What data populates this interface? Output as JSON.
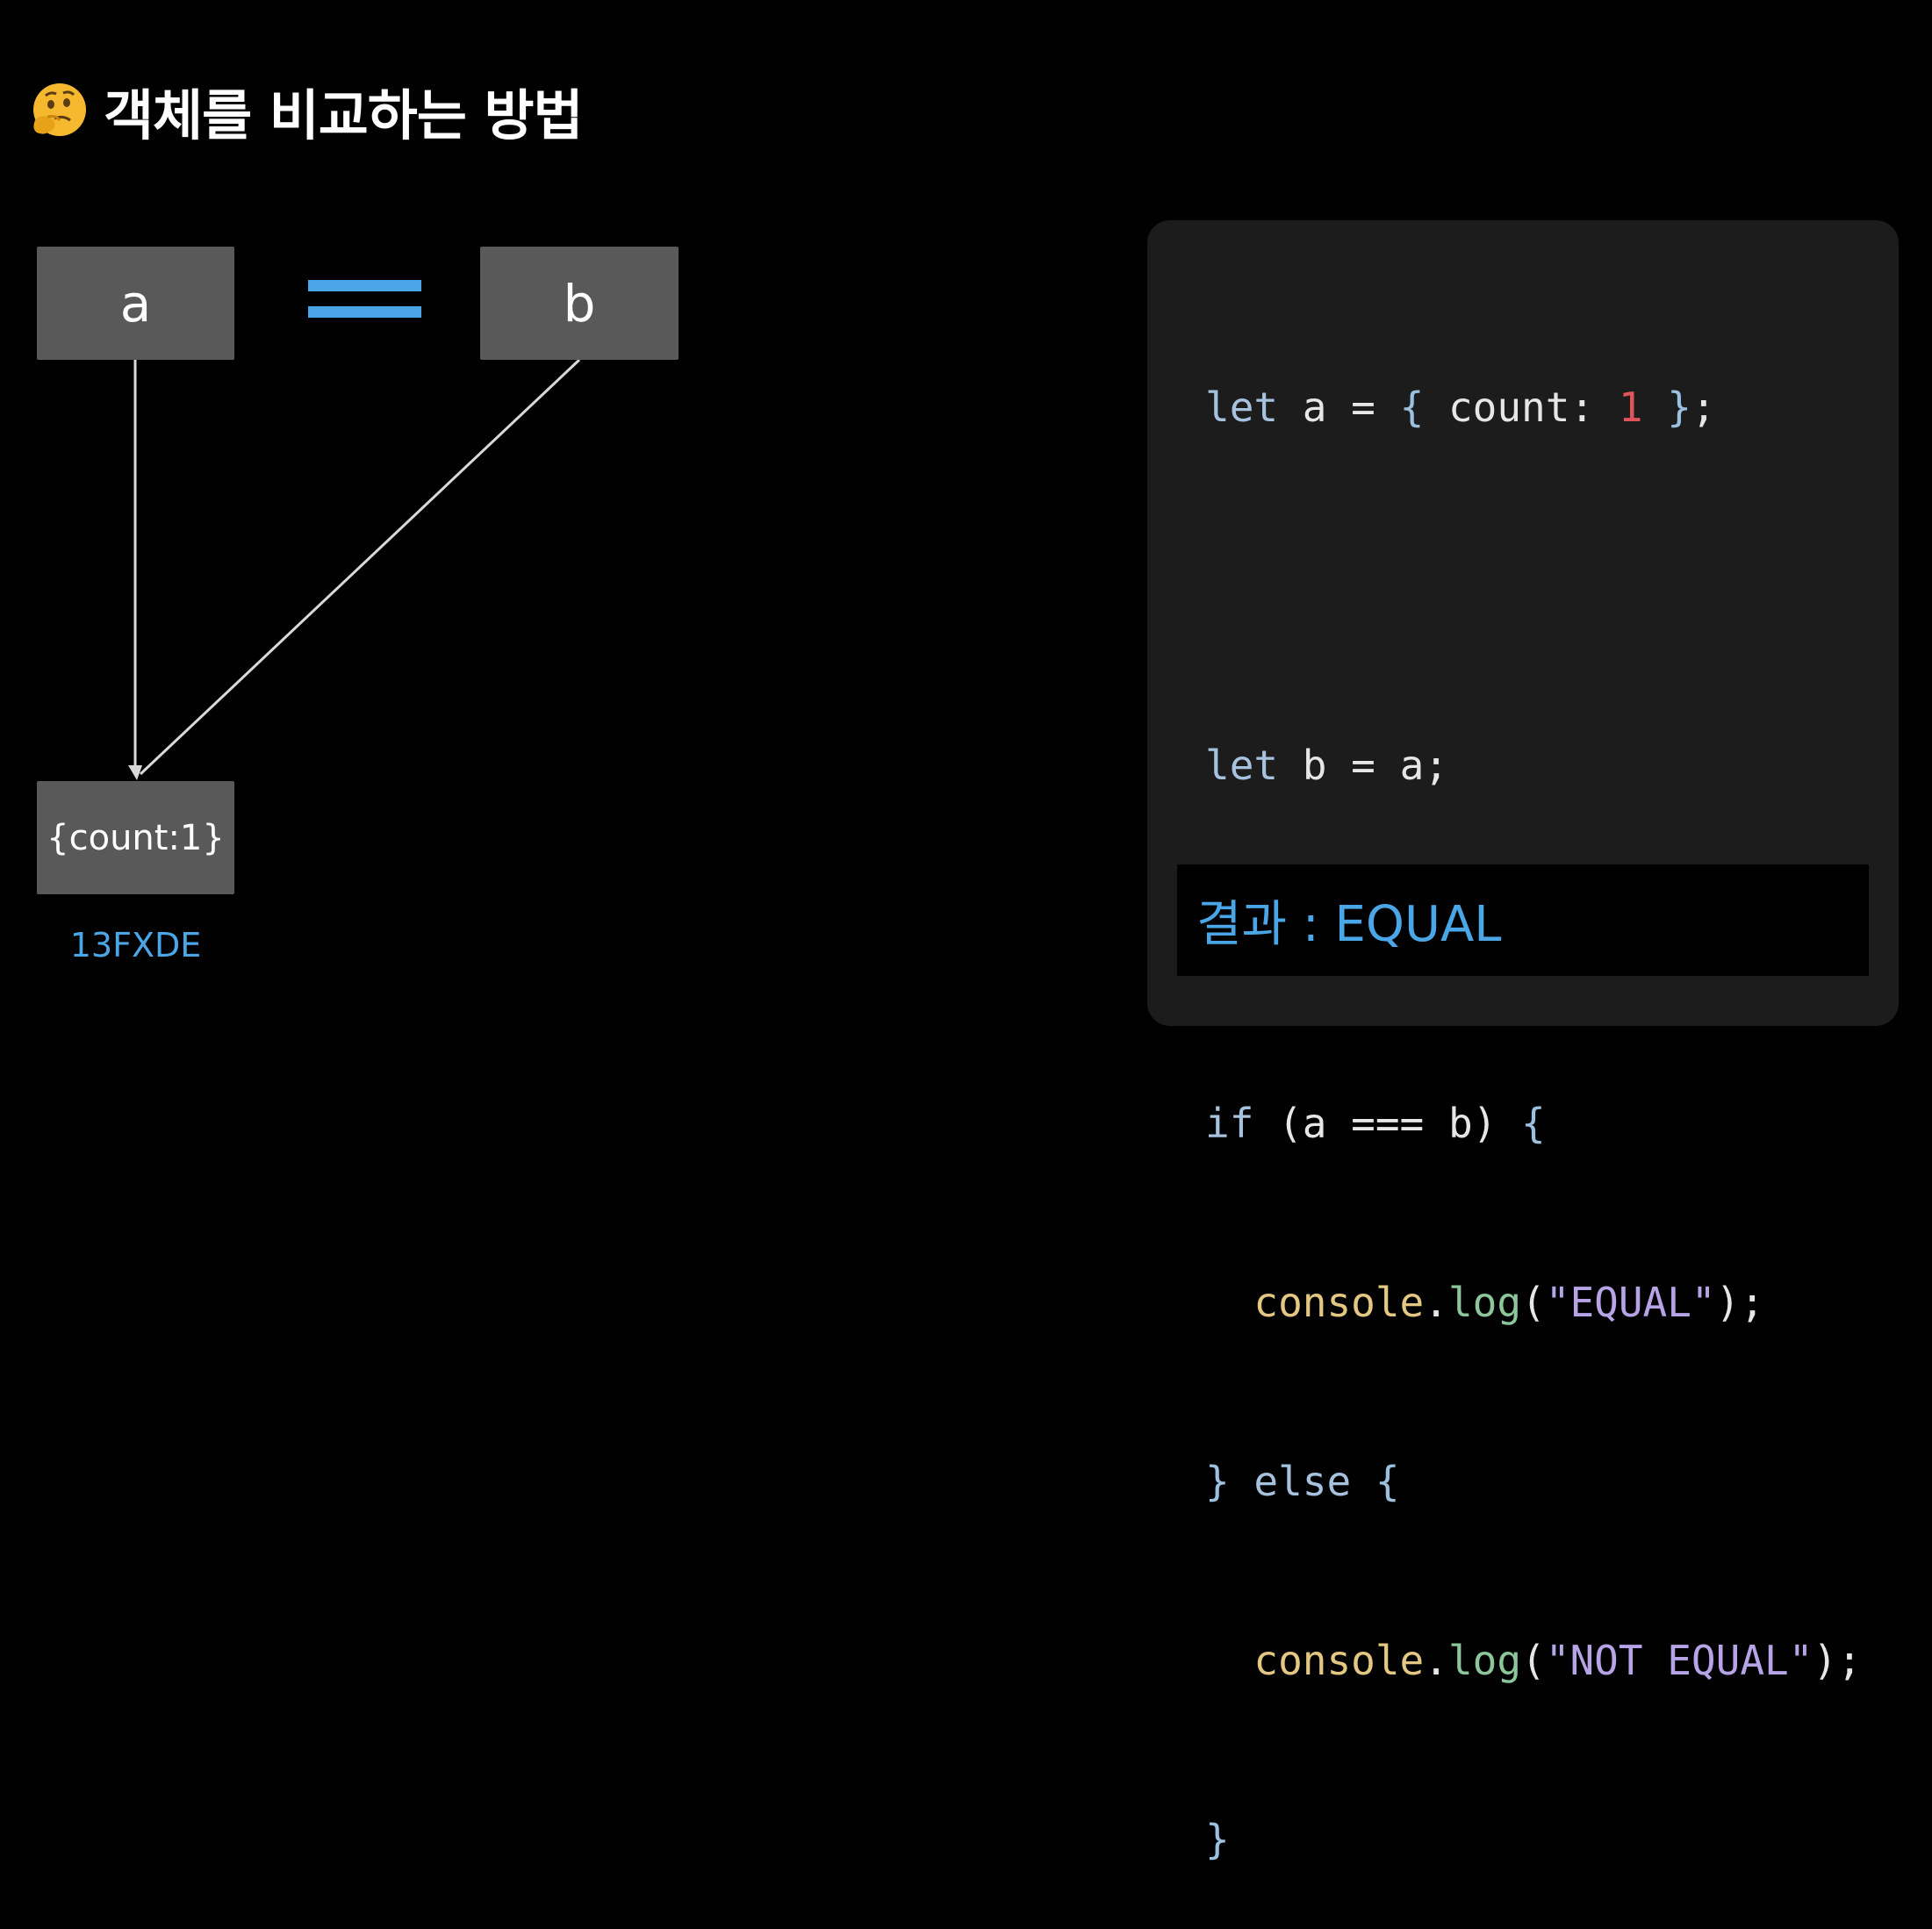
{
  "title": {
    "emoji_icon": "thinking-face-icon",
    "text": "객체를 비교하는 방법"
  },
  "diagram": {
    "box_a_label": "a",
    "box_b_label": "b",
    "object_label": "{count:1}",
    "address": "13FXDE",
    "operator_icon": "double-equals-icon"
  },
  "code": {
    "line1": {
      "t1": "let",
      "t2": " a = ",
      "t3": "{",
      "t4": " count: ",
      "t5": "1",
      "t6": " ",
      "t7": "}",
      "t8": ";"
    },
    "line3": {
      "t1": "let",
      "t2": " b = a;"
    },
    "line5": {
      "t1": "if",
      "t2": " (a === b) ",
      "t3": "{"
    },
    "line6": {
      "t1": "  ",
      "t2": "console",
      "t3": ".",
      "t4": "log",
      "t5": "(",
      "t6": "\"EQUAL\"",
      "t7": ");"
    },
    "line7": {
      "t1": "}",
      "t2": " else ",
      "t3": "{"
    },
    "line8": {
      "t1": "  ",
      "t2": "console",
      "t3": ".",
      "t4": "log",
      "t5": "(",
      "t6": "\"NOT EQUAL\"",
      "t7": ");"
    },
    "line9": {
      "t1": "}"
    }
  },
  "result": {
    "text": "결과 : EQUAL"
  },
  "colors": {
    "accent_blue": "#4aa6e6",
    "box_gray": "#595959",
    "panel_bg": "#1c1c1c"
  }
}
